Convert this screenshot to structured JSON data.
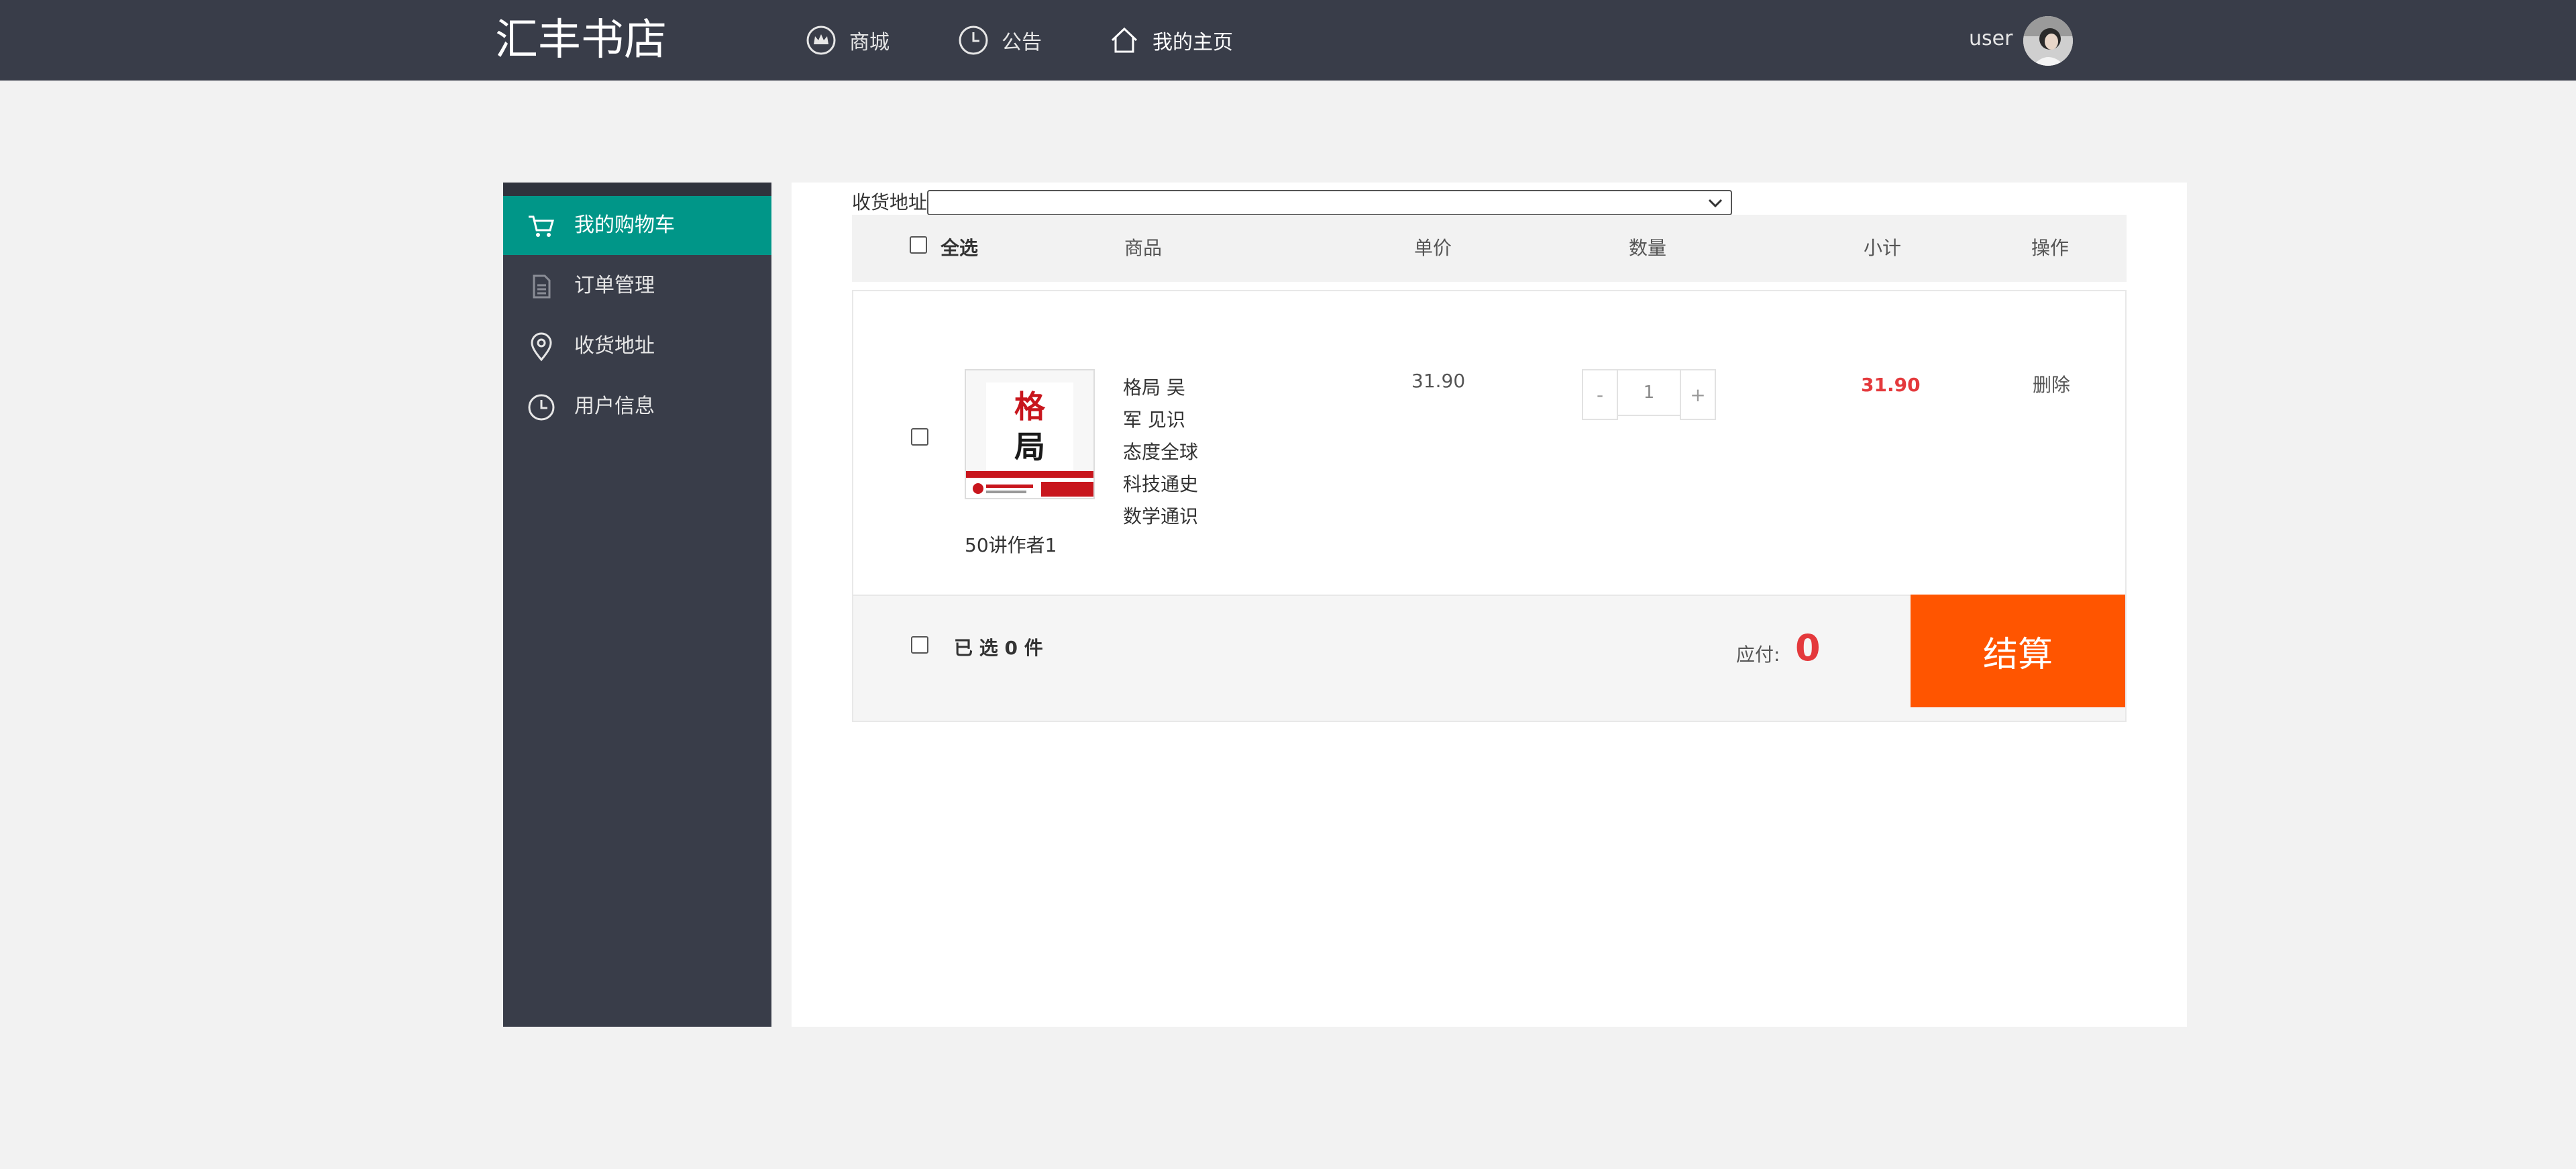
{
  "header": {
    "brand": "汇丰书店",
    "nav": [
      {
        "label": "商城",
        "icon": "crown-icon"
      },
      {
        "label": "公告",
        "icon": "clock-icon"
      },
      {
        "label": "我的主页",
        "icon": "home-icon"
      }
    ],
    "username": "user"
  },
  "sidebar": {
    "items": [
      {
        "label": "我的购物车",
        "icon": "cart-icon",
        "active": true
      },
      {
        "label": "订单管理",
        "icon": "document-icon",
        "active": false
      },
      {
        "label": "收货地址",
        "icon": "location-pin-icon",
        "active": false
      },
      {
        "label": "用户信息",
        "icon": "clock-icon",
        "active": false
      }
    ]
  },
  "cart": {
    "address_label": "收货地址",
    "address_value": "",
    "columns": {
      "select_all": "全选",
      "product": "商品",
      "unit_price": "单价",
      "quantity": "数量",
      "subtotal": "小计",
      "action": "操作"
    },
    "items": [
      {
        "cover_title": "格局",
        "title_lines": [
          "格局 吴",
          "军 见识",
          "态度全球",
          "科技通史",
          "数学通识"
        ],
        "author_line": "50讲作者1",
        "unit_price": "31.90",
        "quantity_minus": "-",
        "quantity": "1",
        "quantity_plus": "+",
        "subtotal": "31.90",
        "delete_label": "删除"
      }
    ],
    "footer": {
      "selected_text": "已 选 0 件",
      "payable_label": "应付:",
      "payable_value": "0",
      "checkout_label": "结算"
    }
  },
  "colors": {
    "header_bg": "#393d49",
    "sidebar_active": "#009688",
    "checkout_bg": "#ff5500",
    "price_red": "#e4393c"
  }
}
